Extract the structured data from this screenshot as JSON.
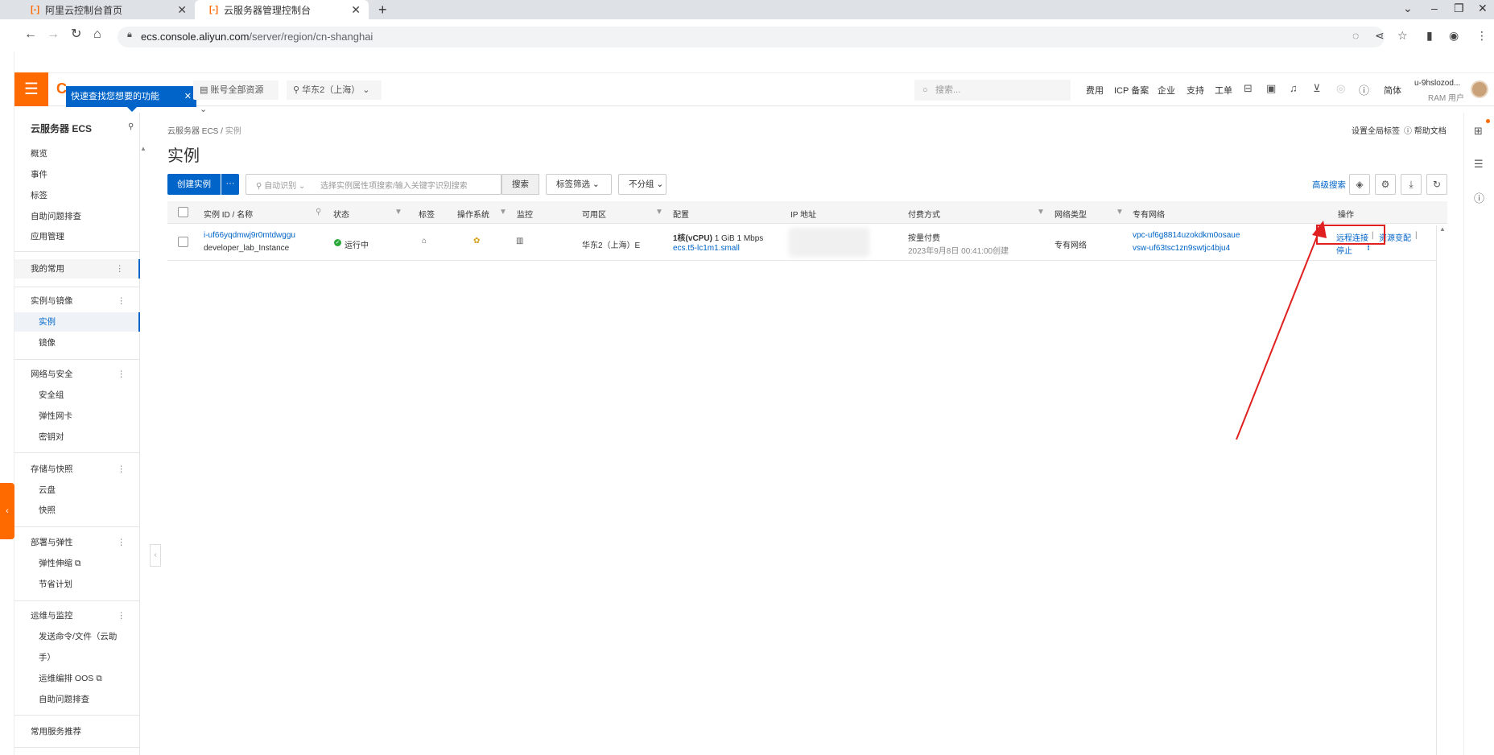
{
  "browser": {
    "tabs": [
      {
        "title": "阿里云控制台首页"
      },
      {
        "title": "云服务器管理控制台"
      }
    ],
    "url_host": "ecs.console.aliyun.com",
    "url_path": "/server/region/cn-shanghai"
  },
  "topbar": {
    "tip": "快速查找您想要的功能",
    "resource_group": "账号全部资源",
    "region": "华东2（上海）",
    "search_placeholder": "搜索...",
    "links": [
      "费用",
      "ICP 备案",
      "企业",
      "支持",
      "工单"
    ],
    "lang": "简体",
    "user_name": "u-9hslozod...",
    "user_role": "RAM 用户"
  },
  "sidebar": {
    "title": "云服务器 ECS",
    "top_items": [
      "概览",
      "事件",
      "标签",
      "自助问题排查",
      "应用管理"
    ],
    "my_common": "我的常用",
    "groups": [
      {
        "label": "实例与镜像",
        "items": [
          "实例",
          "镜像"
        ]
      },
      {
        "label": "网络与安全",
        "items": [
          "安全组",
          "弹性网卡",
          "密钥对"
        ]
      },
      {
        "label": "存储与快照",
        "items": [
          "云盘",
          "快照"
        ]
      },
      {
        "label": "部署与弹性",
        "items": [
          "弹性伸缩",
          "节省计划"
        ]
      },
      {
        "label": "运维与监控",
        "items": [
          "发送命令/文件（云助",
          "手）",
          "运维编排 OOS",
          "自助问题排查"
        ]
      }
    ],
    "bottom": "常用服务推荐"
  },
  "main": {
    "breadcrumb": [
      "云服务器 ECS",
      "实例"
    ],
    "title": "实例",
    "set_tags": "设置全局标签",
    "help_docs": "帮助文档",
    "toolbar": {
      "create": "创建实例",
      "more": "···",
      "filter_mode": "自动识别",
      "filter_placeholder": "选择实例属性项搜索/输入关键字识别搜索",
      "search": "搜索",
      "tag_filter": "标签筛选",
      "group": "不分组",
      "advanced": "高级搜索"
    },
    "table": {
      "headers": [
        "实例 ID / 名称",
        "状态",
        "标签",
        "操作系统",
        "监控",
        "可用区",
        "配置",
        "IP 地址",
        "付费方式",
        "网络类型",
        "专有网络",
        "操作"
      ],
      "row": {
        "id": "i-uf66yqdmwj9r0mtdwggu",
        "name": "developer_lab_Instance",
        "status": "运行中",
        "zone": "华东2（上海）E",
        "config_cpu": "1核(vCPU)",
        "config_mem": "1 GiB 1 Mbps",
        "config_type": "ecs.t5-lc1m1.small",
        "billing": "按量付费",
        "created": "2023年9月8日 00:41:00创建",
        "network": "专有网络",
        "vpc": "vpc-uf6g8814uzokdkm0osaue",
        "vsw": "vsw-uf63tsc1zn9swtjc4bju4",
        "actions": [
          "远程连接",
          "资源变配",
          "停止"
        ]
      }
    }
  },
  "colors": {
    "accent": "#0064c8",
    "brand": "#ff6a00",
    "annotation": "#e02020",
    "running": "#2aa839"
  }
}
